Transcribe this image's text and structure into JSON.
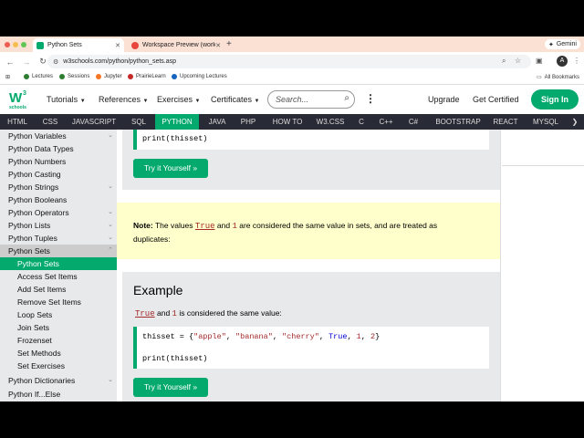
{
  "browser": {
    "tabs": [
      {
        "label": "Python Sets",
        "favicon_color": "#04aa6d"
      },
      {
        "label": "Workspace Preview (workspa",
        "favicon_color": "#e8453c"
      }
    ],
    "new_tab": "+",
    "gemini_label": "Gemini",
    "url": "w3schools.com/python/python_sets.asp",
    "profile_initial": "A",
    "bookmarks": [
      {
        "label": "Lectures",
        "color": "#2e7d32"
      },
      {
        "label": "Sessions",
        "color": "#2e7d32"
      },
      {
        "label": "Jupyter",
        "color": "#f37726"
      },
      {
        "label": "PrairieLearn",
        "color": "#c62828"
      },
      {
        "label": "Upcoming Lectures",
        "color": "#1565c0"
      }
    ],
    "all_bookmarks": "All Bookmarks"
  },
  "header": {
    "logo_text": "schools",
    "menus": [
      "Tutorials",
      "References",
      "Exercises",
      "Certificates"
    ],
    "search_placeholder": "Search...",
    "upgrade": "Upgrade",
    "get_certified": "Get Certified",
    "sign_in": "Sign In"
  },
  "topnav": {
    "items": [
      "HTML",
      "CSS",
      "JAVASCRIPT",
      "SQL",
      "PYTHON",
      "JAVA",
      "PHP",
      "HOW TO",
      "W3.CSS",
      "C",
      "C++",
      "C#",
      "BOOTSTRAP",
      "REACT",
      "MYSQL"
    ],
    "active": "PYTHON"
  },
  "sidebar": {
    "items": [
      {
        "label": "Python Variables",
        "type": "chev"
      },
      {
        "label": "Python Data Types",
        "type": "plain"
      },
      {
        "label": "Python Numbers",
        "type": "plain"
      },
      {
        "label": "Python Casting",
        "type": "plain"
      },
      {
        "label": "Python Strings",
        "type": "chev"
      },
      {
        "label": "Python Booleans",
        "type": "plain"
      },
      {
        "label": "Python Operators",
        "type": "chev"
      },
      {
        "label": "Python Lists",
        "type": "chev"
      },
      {
        "label": "Python Tuples",
        "type": "chev"
      },
      {
        "label": "Python Sets",
        "type": "open"
      },
      {
        "label": "Python Sets",
        "type": "sel"
      },
      {
        "label": "Access Set Items",
        "type": "sub"
      },
      {
        "label": "Add Set Items",
        "type": "sub"
      },
      {
        "label": "Remove Set Items",
        "type": "sub"
      },
      {
        "label": "Loop Sets",
        "type": "sub"
      },
      {
        "label": "Join Sets",
        "type": "sub"
      },
      {
        "label": "Frozenset",
        "type": "sub"
      },
      {
        "label": "Set Methods",
        "type": "sub"
      },
      {
        "label": "Set Exercises",
        "type": "sub"
      },
      {
        "label": "Python Dictionaries",
        "type": "chev"
      },
      {
        "label": "Python If...Else",
        "type": "plain"
      }
    ]
  },
  "main": {
    "top_code": "print(thisset)",
    "try_button": "Try it Yourself »",
    "note": {
      "bold": "Note:",
      "pre": "The values",
      "kw_true": "True",
      "and": "and",
      "kw_one": "1",
      "post": "are considered the same value in sets, and are treated as",
      "line2": "duplicates:"
    },
    "example": {
      "title": "Example",
      "kw_true": "True",
      "and": "and",
      "kw_one": "1",
      "desc": "is considered the same value:",
      "code_line1_a": "thisset = {",
      "code_apple": "\"apple\"",
      "code_banana": "\"banana\"",
      "code_cherry": "\"cherry\"",
      "code_true": "True",
      "code_one": "1",
      "code_two": "2",
      "code_line2": "print(thisset)",
      "try_button": "Try it Yourself »"
    }
  }
}
